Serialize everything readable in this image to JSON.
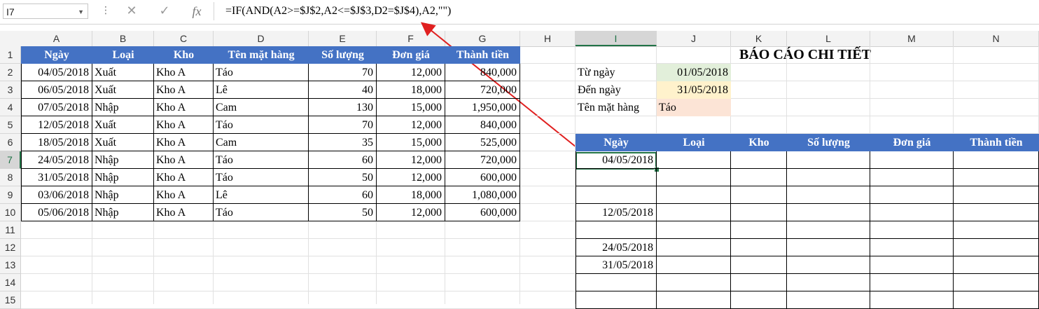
{
  "namebox": {
    "value": "I7"
  },
  "formula_bar": {
    "cancel_icon": "close-icon",
    "enter_icon": "check-icon",
    "fx_label": "fx",
    "formula": "=IF(AND(A2>=$J$2,A2<=$J$3,D2=$J$4),A2,\"\")"
  },
  "columns": [
    "A",
    "B",
    "C",
    "D",
    "E",
    "F",
    "G",
    "H",
    "I",
    "J",
    "K",
    "L",
    "M",
    "N"
  ],
  "rows": [
    "1",
    "2",
    "3",
    "4",
    "5",
    "6",
    "7",
    "8",
    "9",
    "10",
    "11",
    "12",
    "13",
    "14",
    "15"
  ],
  "source_table": {
    "headers": [
      "Ngày",
      "Loại",
      "Kho",
      "Tên mặt hàng",
      "Số lượng",
      "Đơn giá",
      "Thành tiền"
    ],
    "data": [
      [
        "04/05/2018",
        "Xuất",
        "Kho A",
        "Táo",
        "70",
        "12,000",
        "840,000"
      ],
      [
        "06/05/2018",
        "Xuất",
        "Kho A",
        "Lê",
        "40",
        "18,000",
        "720,000"
      ],
      [
        "07/05/2018",
        "Nhập",
        "Kho A",
        "Cam",
        "130",
        "15,000",
        "1,950,000"
      ],
      [
        "12/05/2018",
        "Xuất",
        "Kho A",
        "Táo",
        "70",
        "12,000",
        "840,000"
      ],
      [
        "18/05/2018",
        "Xuất",
        "Kho A",
        "Cam",
        "35",
        "15,000",
        "525,000"
      ],
      [
        "24/05/2018",
        "Nhập",
        "Kho A",
        "Táo",
        "60",
        "12,000",
        "720,000"
      ],
      [
        "31/05/2018",
        "Nhập",
        "Kho A",
        "Táo",
        "50",
        "12,000",
        "600,000"
      ],
      [
        "03/06/2018",
        "Nhập",
        "Kho A",
        "Lê",
        "60",
        "18,000",
        "1,080,000"
      ],
      [
        "05/06/2018",
        "Nhập",
        "Kho A",
        "Táo",
        "50",
        "12,000",
        "600,000"
      ]
    ]
  },
  "report": {
    "title": "BÁO CÁO CHI TIẾT",
    "from_label": "Từ ngày",
    "from_value": "01/05/2018",
    "to_label": "Đến ngày",
    "to_value": "31/05/2018",
    "item_label": "Tên mặt hàng",
    "item_value": "Táo",
    "headers": [
      "Ngày",
      "Loại",
      "Kho",
      "Số lượng",
      "Đơn giá",
      "Thành tiền"
    ],
    "dates": [
      "04/05/2018",
      "",
      "",
      "12/05/2018",
      "",
      "24/05/2018",
      "31/05/2018",
      "",
      ""
    ]
  },
  "colors": {
    "header_blue": "#4472c4",
    "from_fill": "#e2efda",
    "to_fill": "#fff2cc",
    "item_fill": "#fce4d6",
    "arrow": "#e02020"
  }
}
